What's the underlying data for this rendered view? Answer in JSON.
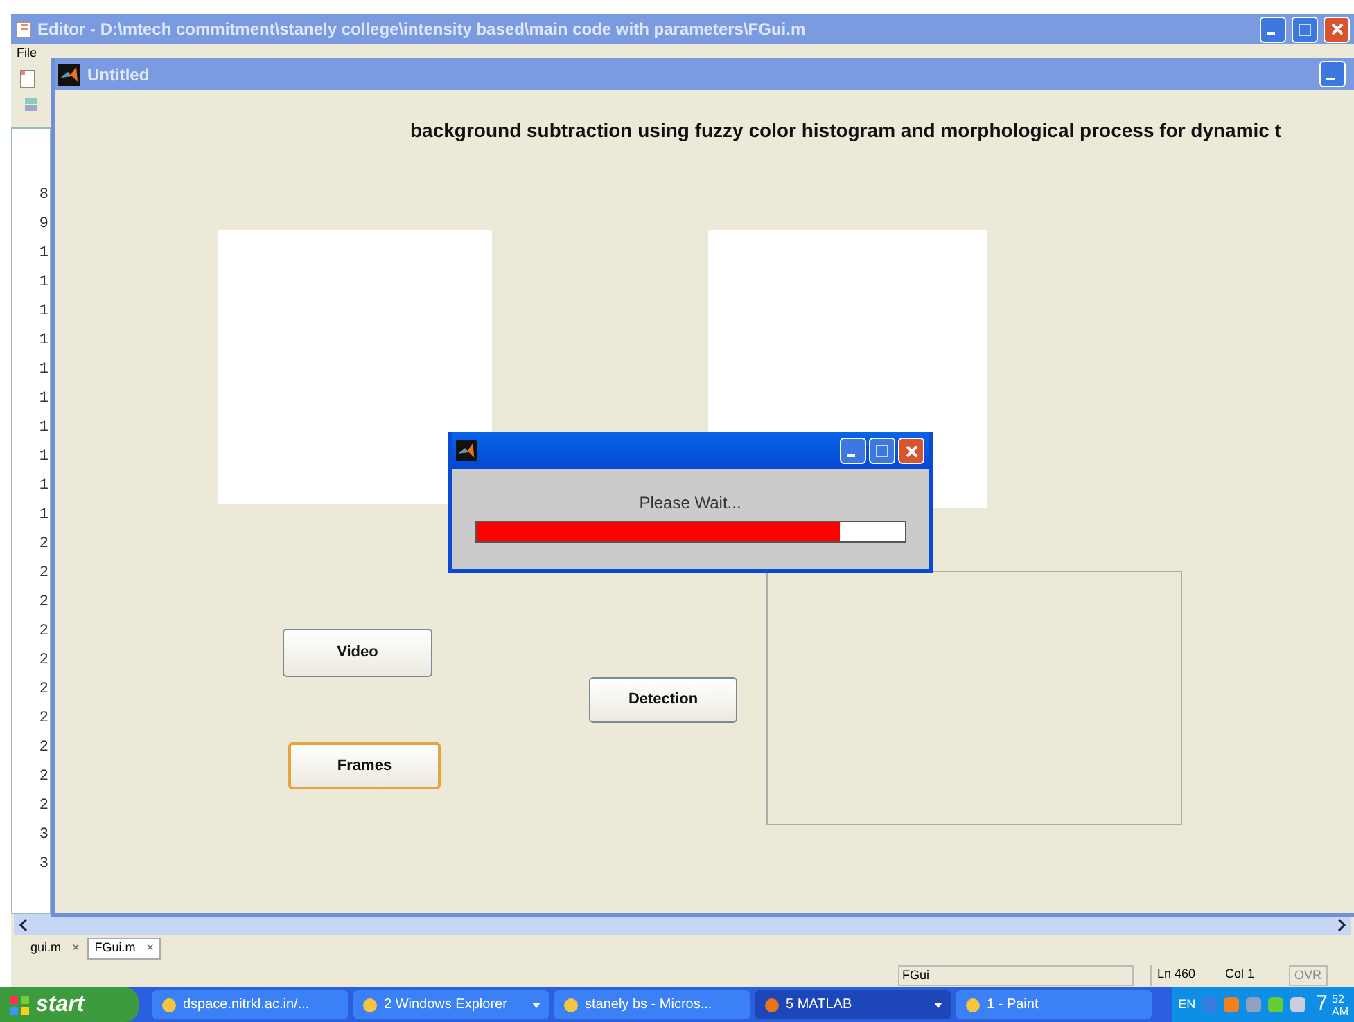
{
  "editor": {
    "title": "Editor - D:\\mtech commitment\\stanely college\\intensity based\\main code with parameters\\FGui.m",
    "menu": [
      "File"
    ],
    "line_numbers": [
      "8",
      "9",
      "1",
      "1",
      "1",
      "1",
      "1",
      "1",
      "1",
      "1",
      "1",
      "1",
      "2",
      "2",
      "2",
      "2",
      "2",
      "2",
      "2",
      "2",
      "2",
      "2",
      "3",
      "3"
    ],
    "tabs": [
      {
        "label": "gui.m",
        "selected": false,
        "close": "×"
      },
      {
        "label": "FGui.m",
        "selected": true,
        "close": "×"
      }
    ],
    "status_bar": {
      "function": "FGui",
      "line": "Ln  460",
      "col": "Col  1",
      "ovr": {
        "label": "OVR",
        "disabled": true
      }
    }
  },
  "figure": {
    "title": "Untitled",
    "heading": "background subtraction using fuzzy color histogram and morphological process for dynamic t",
    "buttons": [
      {
        "label": "Video",
        "focused": false
      },
      {
        "label": "Detection",
        "focused": false
      },
      {
        "label": "Frames",
        "focused": true
      }
    ]
  },
  "progress_dialog": {
    "message": "Please Wait...",
    "level": 0.85
  },
  "taskbar": {
    "start": "start",
    "items": [
      {
        "label": "dspace.nitrkl.ac.in/...",
        "selected": false,
        "dropdown": false
      },
      {
        "label": "2 Windows Explorer",
        "selected": false,
        "dropdown": true
      },
      {
        "label": "stanely bs - Micros...",
        "selected": false,
        "dropdown": false
      },
      {
        "label": "5 MATLAB",
        "selected": true,
        "dropdown": true
      },
      {
        "label": "1 - Paint",
        "selected": false,
        "dropdown": false
      }
    ],
    "language": "EN",
    "clock": {
      "hour": "7",
      "minute": "52",
      "ampm": "AM"
    }
  }
}
